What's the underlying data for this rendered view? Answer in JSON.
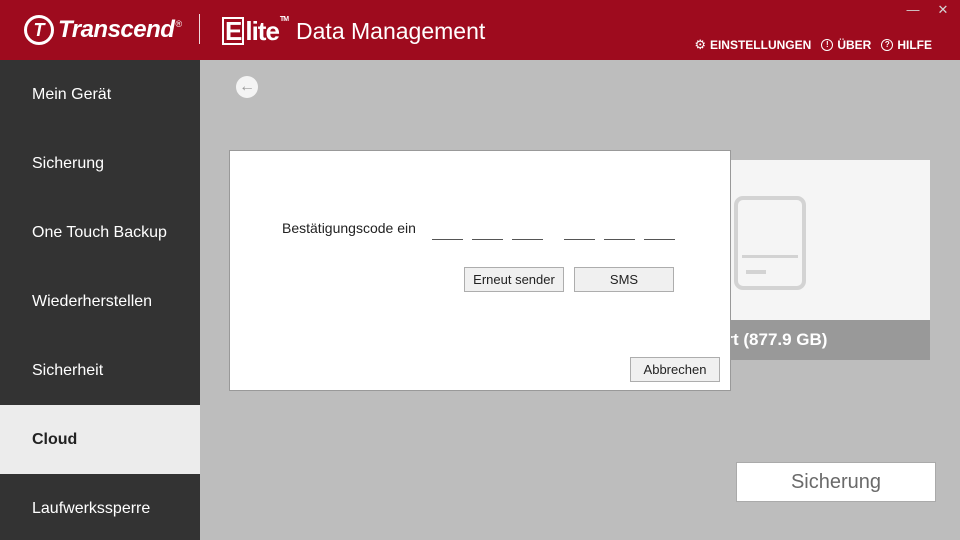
{
  "header": {
    "brand": "Transcend",
    "brand_reg": "®",
    "app_logo": "Elite",
    "app_logo_tm": "TM",
    "app_name": "Data Management",
    "links": [
      {
        "label": "EINSTELLUNGEN",
        "icon": "gear-icon"
      },
      {
        "label": "ÜBER",
        "icon": "exclamation-icon"
      },
      {
        "label": "HILFE",
        "icon": "question-icon"
      }
    ],
    "window": {
      "minimize": "—",
      "close": "✕"
    }
  },
  "sidebar": {
    "items": [
      {
        "label": "Mein Gerät",
        "active": false
      },
      {
        "label": "Sicherung",
        "active": false
      },
      {
        "label": "One Touch Backup",
        "active": false
      },
      {
        "label": "Wiederherstellen",
        "active": false
      },
      {
        "label": "Sicherheit",
        "active": false
      },
      {
        "label": "Cloud",
        "active": true
      },
      {
        "label": "Laufwerkssperre",
        "active": false
      }
    ]
  },
  "main": {
    "device_label": "ort (877.9 GB)",
    "action_label": "Sicherung"
  },
  "dialog": {
    "code_label": "Bestätigungscode ein",
    "resend_label": "Erneut sender",
    "sms_label": "SMS",
    "cancel_label": "Abbrechen"
  },
  "colors": {
    "header": "#9e0b1e",
    "sidebar": "#333333",
    "sidebar_active": "#ececec",
    "content": "#bdbdbd"
  }
}
